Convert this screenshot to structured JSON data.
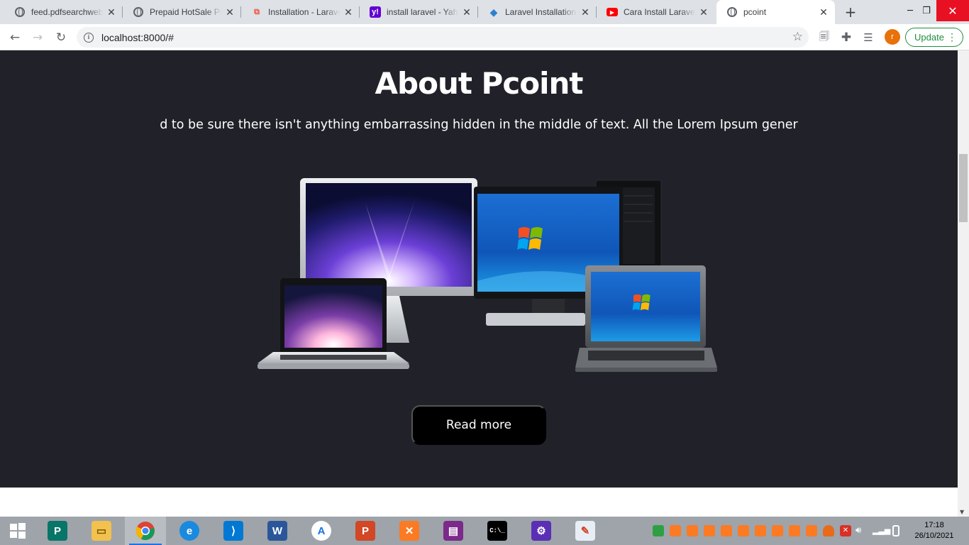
{
  "browser": {
    "tabs": [
      {
        "title": "feed.pdfsearchweb",
        "icon": "globe-icon",
        "active": false
      },
      {
        "title": "Prepaid HotSale Pro",
        "icon": "globe-icon",
        "active": false
      },
      {
        "title": "Installation - Larave",
        "icon": "laravel-icon",
        "active": false
      },
      {
        "title": "install laravel - Yaho",
        "icon": "yahoo-icon",
        "active": false
      },
      {
        "title": "Laravel Installation",
        "icon": "diamond-icon",
        "active": false
      },
      {
        "title": "Cara Install Laravel",
        "icon": "youtube-icon",
        "active": false
      },
      {
        "title": "pcoint",
        "icon": "globe-icon",
        "active": true
      }
    ],
    "url": "localhost:8000/#",
    "avatar_letter": "r",
    "update_label": "Update"
  },
  "page": {
    "about": {
      "title": "About Pcoint",
      "text": "d to be sure there isn't anything embarrassing hidden in the middle of text. All the Lorem Ipsum gener",
      "button_label": "Read more",
      "image_alt": "devices-illustration"
    }
  },
  "taskbar": {
    "apps": [
      "publisher",
      "file-explorer",
      "chrome",
      "edge",
      "vscode",
      "word",
      "app-store",
      "powerpoint",
      "xampp",
      "winrar",
      "command-prompt",
      "settings",
      "paint"
    ],
    "time": "17:18",
    "date": "26/10/2021"
  },
  "colors": {
    "about_bg": "#212229",
    "button_bg": "#000000",
    "update_green": "#1e8e3e",
    "avatar_orange": "#e8710a"
  }
}
